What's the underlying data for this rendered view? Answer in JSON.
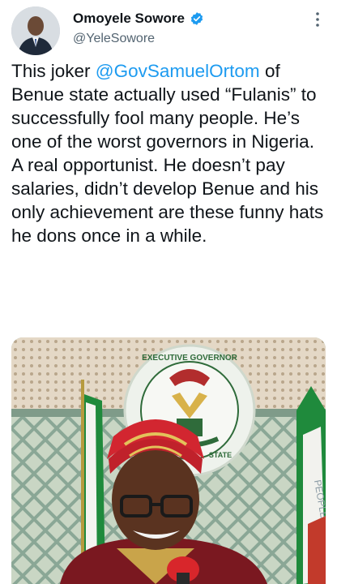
{
  "author": {
    "display_name": "Omoyele Sowore",
    "handle": "@YeleSowore",
    "verified_icon": "verified-badge-icon",
    "avatar_icon": "avatar"
  },
  "tweet": {
    "text_before_mention": "This joker ",
    "mention": "@GovSamuelOrtom",
    "text_after_mention": " of Benue state actually used “Fulanis” to successfully fool many people. He’s one of the worst governors in Nigeria. A real opportunist. He doesn’t pay salaries, didn’t develop Benue and his only achievement are these funny hats he dons once in a while."
  },
  "media": {
    "seal_text_top": "EXECUTIVE GOVERNOR",
    "seal_text_bottom": "STATE",
    "flag_text": "PEOPLE"
  },
  "colors": {
    "mention": "#1d9bf0",
    "verified": "#1d9bf0",
    "handle": "#536471"
  }
}
